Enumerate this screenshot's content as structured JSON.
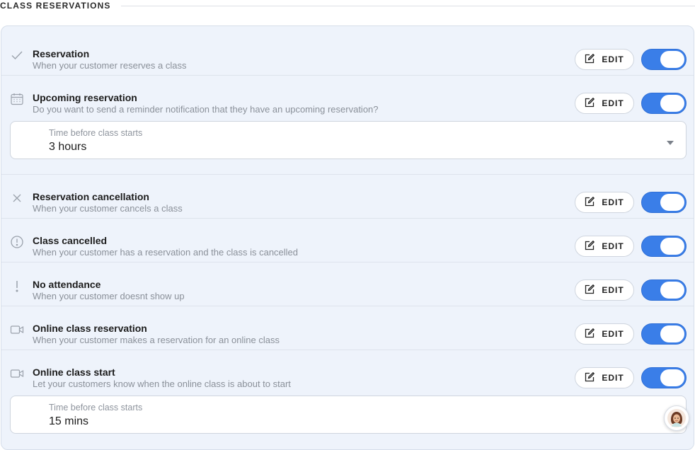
{
  "section": {
    "title": "CLASS RESERVATIONS"
  },
  "edit_label": "EDIT",
  "colors": {
    "accent": "#3a7ee8",
    "card_bg": "#eef3fb"
  },
  "notifications": [
    {
      "icon": "check-icon",
      "title": "Reservation",
      "description": "When your customer reserves a class",
      "enabled": true
    },
    {
      "icon": "calendar-icon",
      "title": "Upcoming reservation",
      "description": "Do you want to send a reminder notification that they have an upcoming reservation?",
      "enabled": true,
      "setting": {
        "label": "Time before class starts",
        "value": "3 hours"
      }
    },
    {
      "icon": "close-icon",
      "title": "Reservation cancellation",
      "description": "When your customer cancels a class",
      "enabled": true
    },
    {
      "icon": "alert-circle-icon",
      "title": "Class cancelled",
      "description": "When your customer has a reservation and the class is cancelled",
      "enabled": true
    },
    {
      "icon": "exclamation-icon",
      "title": "No attendance",
      "description": "When your customer doesnt show up",
      "enabled": true
    },
    {
      "icon": "video-camera-icon",
      "title": "Online class reservation",
      "description": "When your customer makes a reservation for an online class",
      "enabled": true
    },
    {
      "icon": "video-camera-icon",
      "title": "Online class start",
      "description": "Let your customers know when the online class is about to start",
      "enabled": true,
      "setting": {
        "label": "Time before class starts",
        "value": "15 mins"
      }
    }
  ]
}
